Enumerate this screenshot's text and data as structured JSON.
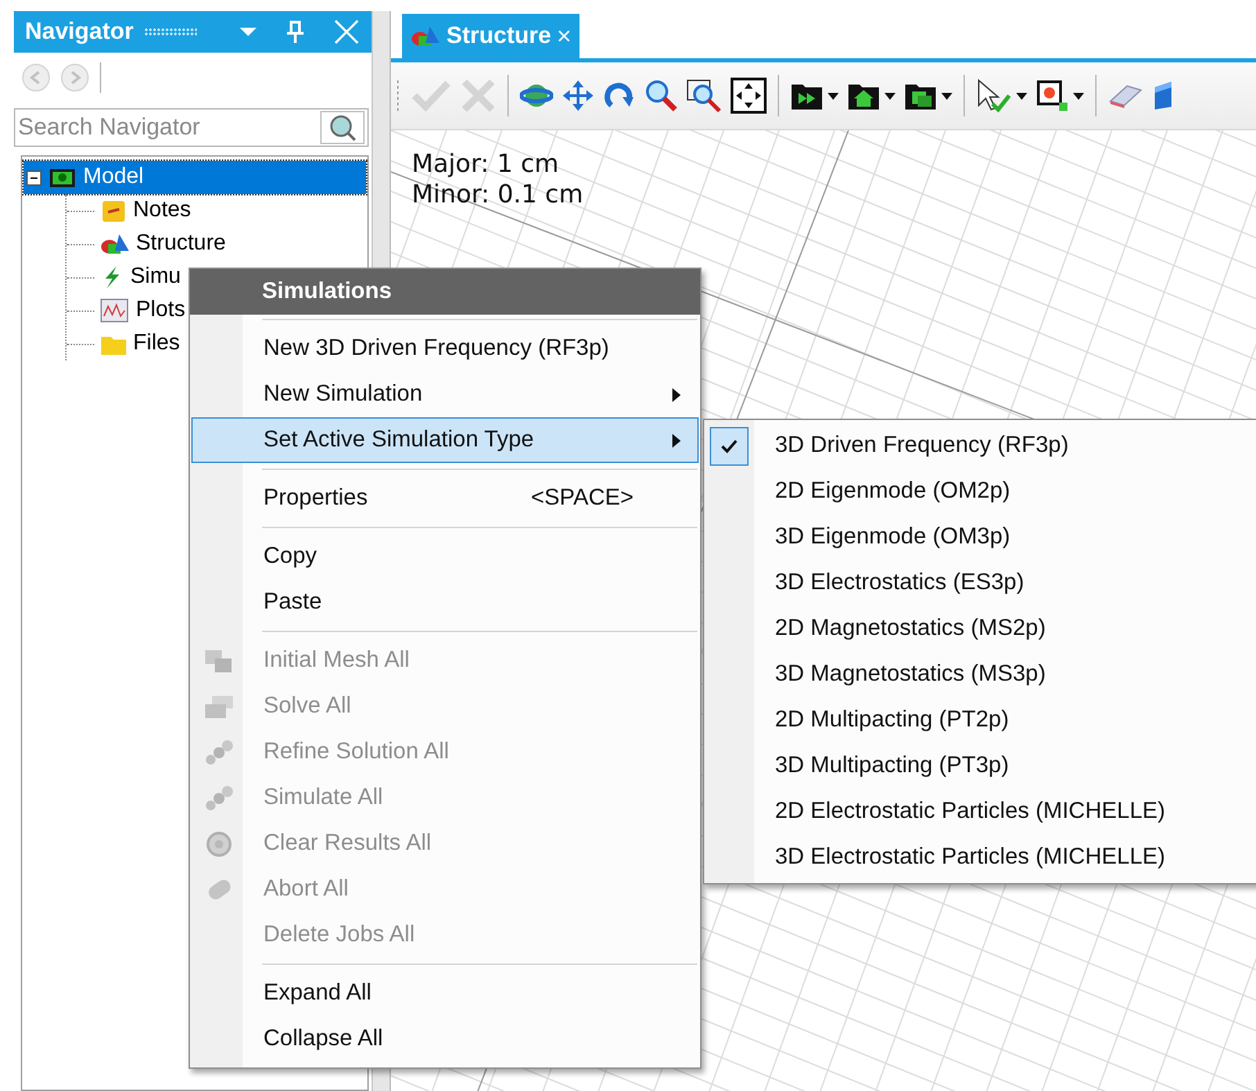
{
  "navigator": {
    "title": "Navigator",
    "nav_buttons": [
      {
        "kind": "back",
        "disabled": true
      },
      {
        "kind": "forward",
        "disabled": true
      }
    ],
    "search": {
      "placeholder": "Search Navigator"
    },
    "tree": [
      {
        "label": "Model",
        "kind": "model",
        "selected": true,
        "expanded": true,
        "children": [
          {
            "label": "Notes",
            "kind": "notes",
            "selected": false
          },
          {
            "label": "Structure",
            "kind": "structure",
            "selected": false
          },
          {
            "label": "Simu",
            "kind": "simulations",
            "selected": false
          },
          {
            "label": "Plots",
            "kind": "plots",
            "selected": false
          },
          {
            "label": "Files",
            "kind": "files",
            "selected": false
          }
        ]
      }
    ]
  },
  "document": {
    "tabs": [
      {
        "label": "Structure",
        "close": "×",
        "selected": true
      }
    ],
    "toolbar": [
      {
        "kind": "check",
        "disabled": true
      },
      {
        "kind": "cross",
        "disabled": true
      },
      {
        "kind": "separator"
      },
      {
        "kind": "orbit",
        "disabled": false
      },
      {
        "kind": "move",
        "disabled": false
      },
      {
        "kind": "rotate",
        "disabled": false
      },
      {
        "kind": "zoom",
        "disabled": false
      },
      {
        "kind": "zoom-box",
        "disabled": false
      },
      {
        "kind": "fit",
        "disabled": false
      },
      {
        "kind": "separator"
      },
      {
        "kind": "run-folder",
        "disabled": false,
        "dropdown": true
      },
      {
        "kind": "home-folder",
        "disabled": false,
        "dropdown": true
      },
      {
        "kind": "folders",
        "disabled": false,
        "dropdown": true
      },
      {
        "kind": "separator"
      },
      {
        "kind": "select",
        "disabled": false,
        "dropdown": true
      },
      {
        "kind": "box-select",
        "disabled": false,
        "dropdown": true
      },
      {
        "kind": "separator"
      },
      {
        "kind": "eraser",
        "disabled": false
      },
      {
        "kind": "cube",
        "disabled": false
      }
    ],
    "viewport": {
      "major": "Major: 1 cm",
      "minor": "Minor: 0.1 cm"
    }
  },
  "context_menu": {
    "title": "Simulations",
    "items": [
      {
        "kind": "item",
        "label": "New 3D Driven Frequency (RF3p)",
        "disabled": false,
        "selected": false
      },
      {
        "kind": "item",
        "label": "New Simulation",
        "submenu": true,
        "disabled": false,
        "selected": false
      },
      {
        "kind": "item",
        "label": "Set Active Simulation Type",
        "submenu": true,
        "disabled": false,
        "selected": true
      },
      {
        "kind": "separator"
      },
      {
        "kind": "item",
        "label": "Properties",
        "shortcut": "<SPACE>",
        "disabled": false,
        "selected": false
      },
      {
        "kind": "separator"
      },
      {
        "kind": "item",
        "label": "Copy",
        "disabled": false,
        "selected": false
      },
      {
        "kind": "item",
        "label": "Paste",
        "disabled": false,
        "selected": false
      },
      {
        "kind": "separator"
      },
      {
        "kind": "mesh",
        "label": "Initial Mesh All",
        "disabled": true,
        "selected": false
      },
      {
        "kind": "solve",
        "label": "Solve All",
        "disabled": true,
        "selected": false
      },
      {
        "kind": "refine",
        "label": "Refine Solution All",
        "disabled": true,
        "selected": false
      },
      {
        "kind": "simulate",
        "label": "Simulate All",
        "disabled": true,
        "selected": false
      },
      {
        "kind": "clear",
        "label": "Clear Results All",
        "disabled": true,
        "selected": false
      },
      {
        "kind": "abort",
        "label": "Abort All",
        "disabled": true,
        "selected": false
      },
      {
        "kind": "item",
        "label": "Delete Jobs All",
        "disabled": true,
        "selected": false
      },
      {
        "kind": "separator"
      },
      {
        "kind": "item",
        "label": "Expand All",
        "disabled": false,
        "selected": false
      },
      {
        "kind": "item",
        "label": "Collapse All",
        "disabled": false,
        "selected": false
      }
    ]
  },
  "submenu": {
    "items": [
      {
        "label": "3D Driven Frequency (RF3p)",
        "checked": true
      },
      {
        "label": "2D Eigenmode (OM2p)",
        "checked": false
      },
      {
        "label": "3D Eigenmode (OM3p)",
        "checked": false
      },
      {
        "label": "3D Electrostatics (ES3p)",
        "checked": false
      },
      {
        "label": "2D Magnetostatics (MS2p)",
        "checked": false
      },
      {
        "label": "3D Magnetostatics (MS3p)",
        "checked": false
      },
      {
        "label": "2D Multipacting (PT2p)",
        "checked": false
      },
      {
        "label": "3D Multipacting (PT3p)",
        "checked": false
      },
      {
        "label": "2D Electrostatic Particles (MICHELLE)",
        "checked": false
      },
      {
        "label": "3D Electrostatic Particles (MICHELLE)",
        "checked": false
      }
    ]
  }
}
